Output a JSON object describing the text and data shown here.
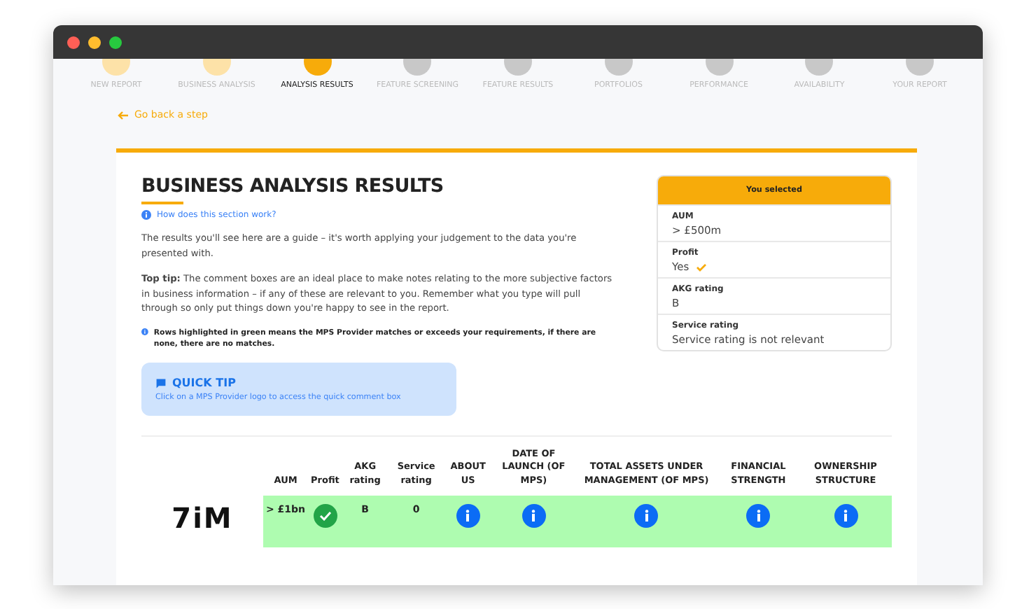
{
  "steps": [
    {
      "label": "NEW REPORT",
      "completed": true,
      "selected": false
    },
    {
      "label": "BUSINESS ANALYSIS",
      "completed": true,
      "selected": false
    },
    {
      "label": "ANALYSIS RESULTS",
      "completed": false,
      "selected": true
    },
    {
      "label": "FEATURE SCREENING",
      "completed": false,
      "selected": false
    },
    {
      "label": "FEATURE RESULTS",
      "completed": false,
      "selected": false
    },
    {
      "label": "PORTFOLIOS",
      "completed": false,
      "selected": false
    },
    {
      "label": "PERFORMANCE",
      "completed": false,
      "selected": false
    },
    {
      "label": "AVAILABILITY",
      "completed": false,
      "selected": false
    },
    {
      "label": "YOUR REPORT",
      "completed": false,
      "selected": false
    }
  ],
  "back_link": "Go back a step",
  "title": "BUSINESS ANALYSIS RESULTS",
  "help_link": "How does this section work?",
  "intro": "The results you'll see here are a guide – it's worth applying your judgement to the data you're presented with.",
  "top_tip": "**Top tip:** The comment boxes are an ideal place to make notes relating to the more subjective factors in business information – if any of these are relevant to you. Remember what you type will pull through so only put things down you're happy to see in the report.",
  "note": "Rows highlighted in green means the MPS Provider matches or exceeds your requirements, if there are none, there are no matches.",
  "quick_tip": {
    "title": "QUICK TIP",
    "text": "Click on a MPS Provider logo to access the quick comment box"
  },
  "selection": {
    "header": "You selected",
    "items": [
      {
        "label": "AUM",
        "value": "> £500m",
        "checked": false
      },
      {
        "label": "Profit",
        "value": "Yes",
        "checked": true
      },
      {
        "label": "AKG rating",
        "value": "B",
        "checked": false
      },
      {
        "label": "Service rating",
        "value": "Service rating is not relevant",
        "checked": false
      }
    ]
  },
  "table": {
    "columns": [
      "AUM",
      "Profit",
      "AKG rating",
      "Service rating",
      "ABOUT US",
      "DATE OF LAUNCH (OF MPS)",
      "TOTAL ASSETS UNDER MANAGEMENT (OF MPS)",
      "FINANCIAL STRENGTH",
      "OWNERSHIP STRUCTURE"
    ],
    "rows": [
      {
        "logo": "7iM",
        "highlighted": true,
        "cells": [
          {
            "kind": "text",
            "text": "> £1bn"
          },
          {
            "kind": "check"
          },
          {
            "kind": "text",
            "text": "B"
          },
          {
            "kind": "text",
            "text": "0"
          },
          {
            "kind": "info"
          },
          {
            "kind": "info"
          },
          {
            "kind": "info"
          },
          {
            "kind": "info"
          },
          {
            "kind": "info"
          }
        ]
      }
    ]
  }
}
